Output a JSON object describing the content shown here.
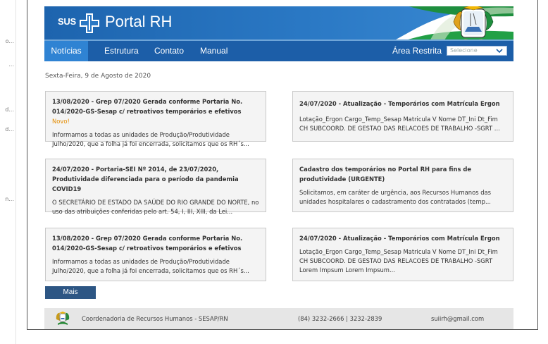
{
  "left_panel": {
    "fragments": [
      "o...",
      "...",
      "d...",
      "d...",
      "n..."
    ]
  },
  "header": {
    "logo_text": "SUS",
    "title": "Portal RH"
  },
  "nav": {
    "items": [
      {
        "label": "Notícias"
      },
      {
        "label": "Estrutura"
      },
      {
        "label": "Contato"
      },
      {
        "label": "Manual"
      }
    ],
    "restricted_label": "Área Restrita",
    "select_placeholder": "Selecione"
  },
  "date": "Sexta-Feira, 9 de Agosto de 2020",
  "news": [
    {
      "title": "13/08/2020 - Grep 07/2020 Gerada conforme Portaria No. 014/2020-GS-Sesap c/ retroativos temporários e efetivos",
      "badge": "Novo!",
      "body": "Informamos a todas as unidades de Produção/Produtividade Julho/2020, que a folha já foi encerrada, solicitamos que os RH´s..."
    },
    {
      "title": "24/07/2020 - Atualização - Temporários com Matrícula Ergon",
      "body": "Lotação_Ergon Cargo_Temp_Sesap Matricula V Nome DT_Ini Dt_Fim CH SUBCOORD. DE GESTAO DAS RELACOES DE TRABALHO -SGRT ..."
    },
    {
      "title": "24/07/2020 - Portaria-SEI Nº 2014, de 23/07/2020, Produtividade diferenciada para o período da pandemia COVID19",
      "body": "O SECRETÁRIO DE ESTADO DA SAÚDE DO RIO GRANDE DO NORTE, no uso das atribuições conferidas pelo art. 54, I, III, XIII, da Lei..."
    },
    {
      "title": "Cadastro dos temporários no Portal RH para fins de produtividade (URGENTE)",
      "body": "Solicitamos, em caráter de urgência, aos Recursos Humanos das unidades hospitalares o cadastramento dos contratados (temp..."
    },
    {
      "title": "13/08/2020 - Grep 07/2020 Gerada conforme Portaria No. 014/2020-GS-Sesap c/ retroativos temporários e efetivos",
      "body": "Informamos a todas as unidades de Produção/Produtividade Julho/2020, que a folha já foi encerrada, solicitamos que os RH´s..."
    },
    {
      "title": "24/07/2020 - Atualização - Temporários com Matrícula Ergon",
      "body": "Lotação_Ergon Cargo_Temp_Sesap Matricula V Nome DT_Ini Dt_Fim CH SUBCOORD. DE GESTAO DAS RELACOES DE TRABALHO -SGRT Lorem Impsum Lorem Impsum..."
    }
  ],
  "more_button": "Mais",
  "footer": {
    "org": "Coordenadoria de Recursos Humanos - SESAP/RN",
    "phone": "(84) 3232-2666 | 3232-2839",
    "email": "suiirh@gmail.com"
  },
  "colors": {
    "header_blue": "#1d64ae",
    "nav_blue": "#1c5ea8",
    "nav_active": "#2f83d3",
    "badge_orange": "#e48c00",
    "button_navy": "#2d5684"
  }
}
